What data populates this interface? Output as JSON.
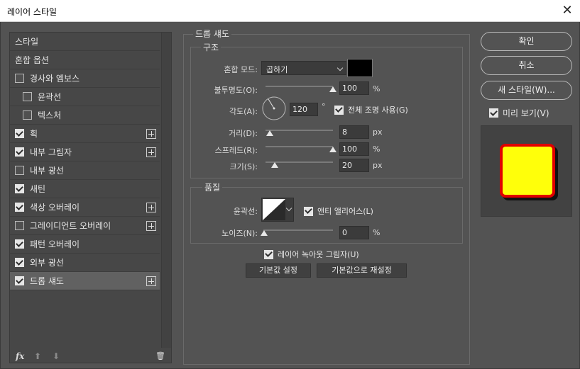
{
  "window": {
    "title": "레이어 스타일",
    "close_glyph": "✕"
  },
  "sidebar": {
    "items": [
      {
        "label": "스타일",
        "checkbox": null,
        "plus": false
      },
      {
        "label": "혼합 옵션",
        "checkbox": null,
        "plus": false
      },
      {
        "label": "경사와 엠보스",
        "checkbox": false,
        "plus": false
      },
      {
        "label": "윤곽선",
        "checkbox": false,
        "plus": false,
        "indent": true
      },
      {
        "label": "텍스처",
        "checkbox": false,
        "plus": false,
        "indent": true
      },
      {
        "label": "획",
        "checkbox": true,
        "plus": true
      },
      {
        "label": "내부 그림자",
        "checkbox": true,
        "plus": true
      },
      {
        "label": "내부 광선",
        "checkbox": false,
        "plus": false
      },
      {
        "label": "새틴",
        "checkbox": true,
        "plus": false
      },
      {
        "label": "색상 오버레이",
        "checkbox": true,
        "plus": true
      },
      {
        "label": "그레이디언트 오버레이",
        "checkbox": false,
        "plus": true
      },
      {
        "label": "패턴 오버레이",
        "checkbox": true,
        "plus": false
      },
      {
        "label": "외부 광선",
        "checkbox": true,
        "plus": false
      },
      {
        "label": "드롭 섀도",
        "checkbox": true,
        "plus": true,
        "selected": true
      }
    ],
    "footer": {
      "fx": "fx",
      "up": "⬆",
      "down": "⬇",
      "trash": "🗑"
    }
  },
  "drop_shadow": {
    "section_title": "드롭 섀도",
    "structure": {
      "title": "구조",
      "blend_mode_label": "혼합 모드:",
      "blend_mode_value": "곱하기",
      "shadow_color": "#000000",
      "opacity_label": "불투명도(O):",
      "opacity_value": "100",
      "opacity_unit": "%",
      "angle_label": "각도(A):",
      "angle_value": "120",
      "angle_unit": "°",
      "global_light_label": "전체 조명 사용(G)",
      "global_light_checked": true,
      "distance_label": "거리(D):",
      "distance_value": "8",
      "distance_unit": "px",
      "spread_label": "스프레드(R):",
      "spread_value": "100",
      "spread_unit": "%",
      "size_label": "크기(S):",
      "size_value": "20",
      "size_unit": "px"
    },
    "quality": {
      "title": "품질",
      "contour_label": "윤곽선:",
      "antialias_label": "앤티 앨리어스(L)",
      "antialias_checked": true,
      "noise_label": "노이즈(N):",
      "noise_value": "0",
      "noise_unit": "%"
    },
    "knockout_label": "레이어 녹아웃 그림자(U)",
    "knockout_checked": true,
    "make_default_label": "기본값 설정",
    "reset_default_label": "기본값으로 재설정"
  },
  "actions": {
    "ok_label": "확인",
    "cancel_label": "취소",
    "new_style_label": "새 스타일(W)...",
    "preview_label": "미리 보기(V)",
    "preview_checked": true
  },
  "preview": {
    "fill_color": "#ffff0a",
    "stroke_color": "#e00000"
  }
}
